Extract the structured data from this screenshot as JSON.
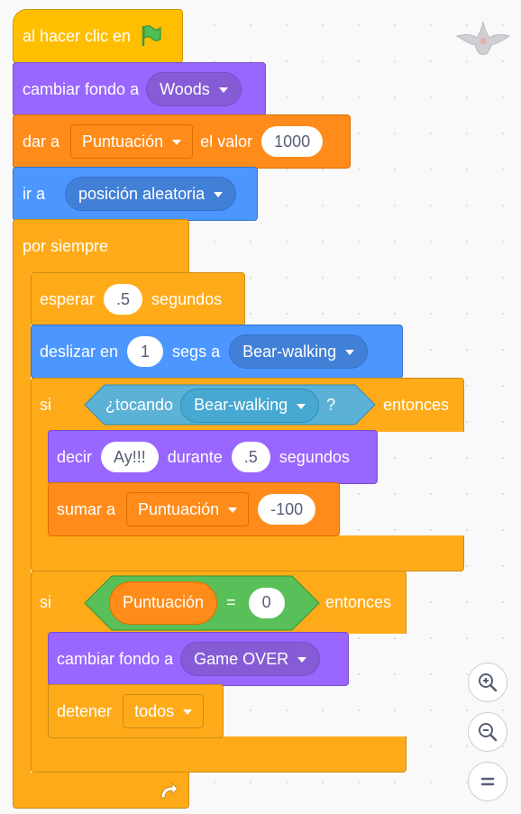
{
  "colors": {
    "events": "#ffbf00",
    "looks": "#9966ff",
    "variables": "#ff8c1a",
    "motion": "#4c97ff",
    "control": "#ffab19",
    "sensing": "#5cb1d6",
    "operators": "#59c059",
    "flag": "#4cbf56"
  },
  "blocks": {
    "when_flag": {
      "label": "al hacer clic en",
      "icon": "green-flag-icon"
    },
    "switch_backdrop": {
      "label": "cambiar fondo a",
      "value": "Woods"
    },
    "set_var": {
      "label": "dar a",
      "variable": "Puntuación",
      "label2": "el valor",
      "value": "1000"
    },
    "go_to": {
      "label": "ir a",
      "value": "posición aleatoria"
    },
    "forever": {
      "label": "por siempre",
      "icon": "loop-arrow-icon"
    },
    "wait": {
      "label": "esperar",
      "value": ".5",
      "label2": "segundos"
    },
    "glide": {
      "label": "deslizar en",
      "value": "1",
      "label2": "segs a",
      "target": "Bear-walking"
    },
    "if1": {
      "label": "si",
      "label2": "entonces",
      "cond_label": "¿tocando",
      "cond_value": "Bear-walking",
      "cond_q": "?"
    },
    "say": {
      "label": "decir",
      "value": "Ay!!!",
      "label2": "durante",
      "value2": ".5",
      "label3": "segundos"
    },
    "change_var": {
      "label": "sumar a",
      "variable": "Puntuación",
      "value": "-100"
    },
    "if2": {
      "label": "si",
      "label2": "entonces",
      "reporter": "Puntuación",
      "op": "=",
      "value": "0"
    },
    "switch_backdrop2": {
      "label": "cambiar fondo a",
      "value": "Game OVER"
    },
    "stop": {
      "label": "detener",
      "value": "todos"
    }
  },
  "sprite_icon": "bat-sprite-icon",
  "zoom": [
    "zoom-in-icon",
    "zoom-out-icon",
    "zoom-reset-icon"
  ]
}
